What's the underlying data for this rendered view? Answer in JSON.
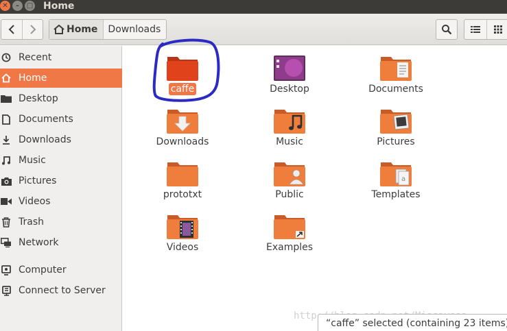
{
  "window": {
    "title": "Home"
  },
  "toolbar": {
    "path": [
      "Home",
      "Downloads"
    ]
  },
  "sidebar": {
    "items": [
      {
        "label": "Recent",
        "icon": "clock-icon"
      },
      {
        "label": "Home",
        "icon": "home-icon",
        "active": true
      },
      {
        "label": "Desktop",
        "icon": "folder-icon"
      },
      {
        "label": "Documents",
        "icon": "document-icon"
      },
      {
        "label": "Downloads",
        "icon": "download-icon"
      },
      {
        "label": "Music",
        "icon": "music-icon"
      },
      {
        "label": "Pictures",
        "icon": "camera-icon"
      },
      {
        "label": "Videos",
        "icon": "video-icon"
      },
      {
        "label": "Trash",
        "icon": "trash-icon"
      },
      {
        "label": "Network",
        "icon": "network-icon"
      },
      {
        "label": "Computer",
        "icon": "computer-icon"
      },
      {
        "label": "Connect to Server",
        "icon": "server-icon"
      }
    ]
  },
  "files": [
    {
      "name": "caffe",
      "kind": "plain",
      "selected": true
    },
    {
      "name": "Desktop",
      "kind": "desktop"
    },
    {
      "name": "Documents",
      "kind": "documents"
    },
    {
      "name": "Downloads",
      "kind": "downloads"
    },
    {
      "name": "Music",
      "kind": "music"
    },
    {
      "name": "Pictures",
      "kind": "pictures"
    },
    {
      "name": "prototxt",
      "kind": "plain"
    },
    {
      "name": "Public",
      "kind": "public"
    },
    {
      "name": "Templates",
      "kind": "templates"
    },
    {
      "name": "Videos",
      "kind": "videos"
    },
    {
      "name": "Examples",
      "kind": "examples"
    }
  ],
  "status": {
    "text": "“caffe” selected  (containing 23 items)"
  },
  "watermark": "http://blog.csdn.net/Missayaaa",
  "colors": {
    "accent": "#f07746",
    "folder_selected": "#e0431b",
    "folder": "#ef7d3c",
    "annotation": "#2b2bc4"
  }
}
